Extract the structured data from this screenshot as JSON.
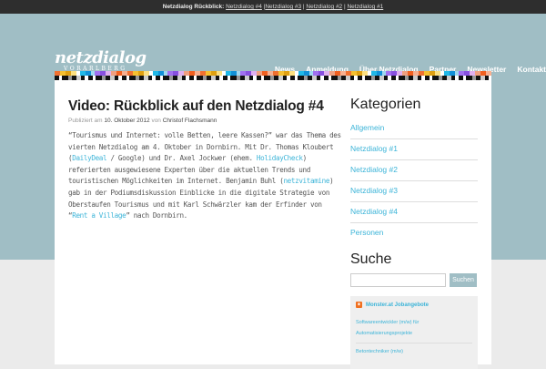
{
  "topbar": {
    "label": "Netzdialog Rückblick:",
    "links": [
      "Netzdialog #4",
      "Netzdialog #3",
      "Netzdialog #2",
      "Netzdialog #1"
    ]
  },
  "logo": {
    "title": "netzdialog",
    "subtitle": "VORARLBERG"
  },
  "nav": [
    "News",
    "Anmeldung",
    "Über Netzdialog",
    "Partner",
    "Newsletter",
    "Kontakt"
  ],
  "post": {
    "title": "Video: Rückblick auf den Netzdialog #4",
    "published_prefix": "Publiziert am",
    "date": "10. Oktober 2012",
    "by": "von",
    "author": "Christof Flachsmann",
    "p1": "“Tourismus und Internet: volle Betten, leere Kassen?” war das Thema des vierten Netzdialog am 4. Oktober in Dornbirn.  Mit Dr. Thomas Kloubert (",
    "l1": "DailyDeal",
    "p2": " / Google) und Dr. Axel Jockwer (ehem. ",
    "l2": "HolidayCheck",
    "p3": ") referierten ausgewiesene Experten über die aktuellen Trends und touristischen Möglichkeiten im Internet. Benjamin Buhl (",
    "l3": "netzvitamine",
    "p4": ") gab in der Podiumsdiskussion Einblicke in die digitale Strategie von Oberstaufen Tourismus und mit Karl Schwärzler kam der Erfinder von “",
    "l4": "Rent a Village",
    "p5": "” nach Dornbirn."
  },
  "sidebar": {
    "categories_title": "Kategorien",
    "categories": [
      "Allgemein",
      "Netzdialog #1",
      "Netzdialog #2",
      "Netzdialog #3",
      "Netzdialog #4",
      "Personen"
    ],
    "search_title": "Suche",
    "search_value": "",
    "search_button": "Suchen",
    "jobs_title": "Monster.at Jobangebote",
    "jobs": [
      "Softwareentwickler (m/w) für Automatisierungsprojekte",
      "Betontechniker (m/w)"
    ]
  },
  "colors": {
    "accent": "#3cb4d8",
    "header_bg": "#a0bec5"
  }
}
